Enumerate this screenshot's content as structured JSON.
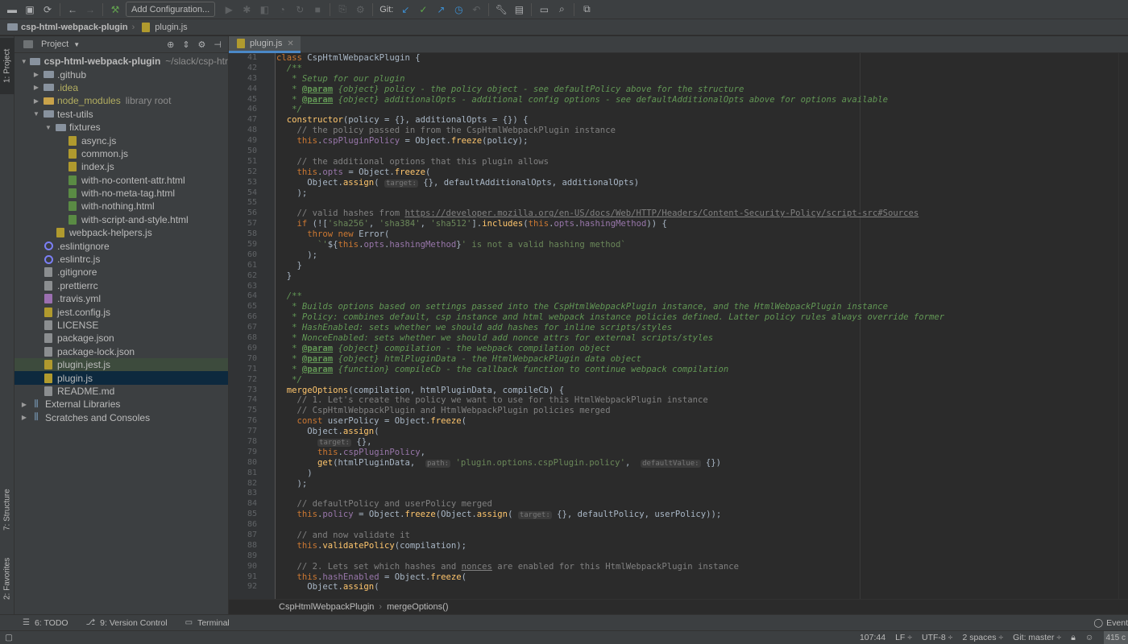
{
  "toolbar": {
    "add_config_label": "Add Configuration...",
    "git_label": "Git:"
  },
  "navbar": {
    "project": "csp-html-webpack-plugin",
    "file": "plugin.js"
  },
  "left_stripe": {
    "project_tab": "1: Project",
    "structure_tab": "7: Structure",
    "favorites_tab": "2: Favorites"
  },
  "project_panel": {
    "title": "Project",
    "tree": [
      {
        "indent": 0,
        "arrow": "▼",
        "icon": "folder",
        "label": "csp-html-webpack-plugin",
        "suffix": "~/slack/csp-htr",
        "bold": true
      },
      {
        "indent": 1,
        "arrow": "▶",
        "icon": "folder",
        "label": ".github"
      },
      {
        "indent": 1,
        "arrow": "▶",
        "icon": "folder",
        "label": ".idea",
        "ignored": true
      },
      {
        "indent": 1,
        "arrow": "▶",
        "icon": "folder-yellow",
        "label": "node_modules",
        "suffix": "library root",
        "ignored": true
      },
      {
        "indent": 1,
        "arrow": "▼",
        "icon": "folder",
        "label": "test-utils"
      },
      {
        "indent": 2,
        "arrow": "▼",
        "icon": "folder",
        "label": "fixtures"
      },
      {
        "indent": 3,
        "arrow": "",
        "icon": "js",
        "label": "async.js"
      },
      {
        "indent": 3,
        "arrow": "",
        "icon": "js",
        "label": "common.js"
      },
      {
        "indent": 3,
        "arrow": "",
        "icon": "js",
        "label": "index.js"
      },
      {
        "indent": 3,
        "arrow": "",
        "icon": "html",
        "label": "with-no-content-attr.html"
      },
      {
        "indent": 3,
        "arrow": "",
        "icon": "html",
        "label": "with-no-meta-tag.html"
      },
      {
        "indent": 3,
        "arrow": "",
        "icon": "html",
        "label": "with-nothing.html"
      },
      {
        "indent": 3,
        "arrow": "",
        "icon": "html",
        "label": "with-script-and-style.html"
      },
      {
        "indent": 2,
        "arrow": "",
        "icon": "js",
        "label": "webpack-helpers.js"
      },
      {
        "indent": 1,
        "arrow": "",
        "icon": "ring",
        "label": ".eslintignore"
      },
      {
        "indent": 1,
        "arrow": "",
        "icon": "ring",
        "label": ".eslintrc.js"
      },
      {
        "indent": 1,
        "arrow": "",
        "icon": "cfg",
        "label": ".gitignore"
      },
      {
        "indent": 1,
        "arrow": "",
        "icon": "cfg",
        "label": ".prettierrc"
      },
      {
        "indent": 1,
        "arrow": "",
        "icon": "yml",
        "label": ".travis.yml"
      },
      {
        "indent": 1,
        "arrow": "",
        "icon": "js",
        "label": "jest.config.js"
      },
      {
        "indent": 1,
        "arrow": "",
        "icon": "cfg",
        "label": "LICENSE"
      },
      {
        "indent": 1,
        "arrow": "",
        "icon": "cfg",
        "label": "package.json"
      },
      {
        "indent": 1,
        "arrow": "",
        "icon": "cfg",
        "label": "package-lock.json"
      },
      {
        "indent": 1,
        "arrow": "",
        "icon": "js",
        "label": "plugin.jest.js",
        "state": "selected-dim"
      },
      {
        "indent": 1,
        "arrow": "",
        "icon": "js",
        "label": "plugin.js",
        "state": "selected"
      },
      {
        "indent": 1,
        "arrow": "",
        "icon": "cfg",
        "label": "README.md"
      },
      {
        "indent": 0,
        "arrow": "▶",
        "icon": "lib",
        "label": "External Libraries"
      },
      {
        "indent": 0,
        "arrow": "▶",
        "icon": "lib",
        "label": "Scratches and Consoles"
      }
    ]
  },
  "editor": {
    "tab_label": "plugin.js",
    "first_line": 41,
    "lines": [
      [
        [
          "k",
          "class "
        ],
        [
          "t",
          "CspHtmlWebpackPlugin {"
        ]
      ],
      [
        [
          "d",
          "  /**"
        ]
      ],
      [
        [
          "d",
          "   * Setup for our plugin"
        ]
      ],
      [
        [
          "d",
          "   * "
        ],
        [
          "dt",
          "@param"
        ],
        [
          "d",
          " {object} policy - the policy object - see defaultPolicy above for the structure"
        ]
      ],
      [
        [
          "d",
          "   * "
        ],
        [
          "dt",
          "@param"
        ],
        [
          "d",
          " {object} additionalOpts - additional config options - see defaultAdditionalOpts above for options available"
        ]
      ],
      [
        [
          "d",
          "   */"
        ]
      ],
      [
        [
          "f",
          "  constructor"
        ],
        [
          "t",
          "(policy = {}, additionalOpts = {}) {"
        ]
      ],
      [
        [
          "c",
          "    // the policy passed in from the CspHtmlWebpackPlugin instance"
        ]
      ],
      [
        [
          "k",
          "    this"
        ],
        [
          "t",
          "."
        ],
        [
          "p",
          "cspPluginPolicy"
        ],
        [
          "t",
          " = Object."
        ],
        [
          "f",
          "freeze"
        ],
        [
          "t",
          "(policy);"
        ]
      ],
      [
        [
          "t",
          ""
        ]
      ],
      [
        [
          "c",
          "    // the additional options that this plugin allows"
        ]
      ],
      [
        [
          "k",
          "    this"
        ],
        [
          "t",
          "."
        ],
        [
          "p",
          "opts"
        ],
        [
          "t",
          " = Object."
        ],
        [
          "f",
          "freeze"
        ],
        [
          "t",
          "("
        ]
      ],
      [
        [
          "t",
          "      Object."
        ],
        [
          "f",
          "assign"
        ],
        [
          "t",
          "( "
        ],
        [
          "h",
          "target:"
        ],
        [
          "t",
          " {}, defaultAdditionalOpts, additionalOpts)"
        ]
      ],
      [
        [
          "t",
          "    );"
        ]
      ],
      [
        [
          "t",
          ""
        ]
      ],
      [
        [
          "c",
          "    // valid hashes from "
        ],
        [
          "cu",
          "https://developer.mozilla.org/en-US/docs/Web/HTTP/Headers/Content-Security-Policy/script-src#Sources"
        ]
      ],
      [
        [
          "k",
          "    if "
        ],
        [
          "t",
          "(!["
        ],
        [
          "s",
          "'sha256'"
        ],
        [
          "t",
          ", "
        ],
        [
          "s",
          "'sha384'"
        ],
        [
          "t",
          ", "
        ],
        [
          "s",
          "'sha512'"
        ],
        [
          "t",
          "]."
        ],
        [
          "f",
          "includes"
        ],
        [
          "t",
          "("
        ],
        [
          "k",
          "this"
        ],
        [
          "t",
          "."
        ],
        [
          "p",
          "opts"
        ],
        [
          "t",
          "."
        ],
        [
          "p",
          "hashingMethod"
        ],
        [
          "t",
          ")) {"
        ]
      ],
      [
        [
          "k",
          "      throw new "
        ],
        [
          "t",
          "Error("
        ]
      ],
      [
        [
          "s",
          "        `'"
        ],
        [
          "t",
          "${"
        ],
        [
          "k",
          "this"
        ],
        [
          "t",
          "."
        ],
        [
          "p",
          "opts"
        ],
        [
          "t",
          "."
        ],
        [
          "p",
          "hashingMethod"
        ],
        [
          "t",
          "}"
        ],
        [
          "s",
          "' is not a valid hashing method`"
        ]
      ],
      [
        [
          "t",
          "      );"
        ]
      ],
      [
        [
          "t",
          "    }"
        ]
      ],
      [
        [
          "t",
          "  }"
        ]
      ],
      [
        [
          "t",
          ""
        ]
      ],
      [
        [
          "d",
          "  /**"
        ]
      ],
      [
        [
          "d",
          "   * Builds options based on settings passed into the CspHtmlWebpackPlugin instance, and the HtmlWebpackPlugin instance"
        ]
      ],
      [
        [
          "d",
          "   * Policy: combines default, csp instance and html webpack instance policies defined. Latter policy rules always override former"
        ]
      ],
      [
        [
          "d",
          "   * HashEnabled: sets whether we should add hashes for inline scripts/styles"
        ]
      ],
      [
        [
          "d",
          "   * NonceEnabled: sets whether we should add nonce attrs for external scripts/styles"
        ]
      ],
      [
        [
          "d",
          "   * "
        ],
        [
          "dt",
          "@param"
        ],
        [
          "d",
          " {object} compilation - the webpack compilation object"
        ]
      ],
      [
        [
          "d",
          "   * "
        ],
        [
          "dt",
          "@param"
        ],
        [
          "d",
          " {object} htmlPluginData - the HtmlWebpackPlugin data object"
        ]
      ],
      [
        [
          "d",
          "   * "
        ],
        [
          "dt",
          "@param"
        ],
        [
          "d",
          " {function} compileCb - the callback function to continue webpack compilation"
        ]
      ],
      [
        [
          "d",
          "   */"
        ]
      ],
      [
        [
          "f",
          "  mergeOptions"
        ],
        [
          "t",
          "(compilation, htmlPluginData, compileCb) {"
        ]
      ],
      [
        [
          "c",
          "    // 1. Let's create the policy we want to use for this HtmlWebpackPlugin instance"
        ]
      ],
      [
        [
          "c",
          "    // CspHtmlWebpackPlugin and HtmlWebpackPlugin policies merged"
        ]
      ],
      [
        [
          "k",
          "    const "
        ],
        [
          "t",
          "userPolicy = Object."
        ],
        [
          "f",
          "freeze"
        ],
        [
          "t",
          "("
        ]
      ],
      [
        [
          "t",
          "      Object."
        ],
        [
          "f",
          "assign"
        ],
        [
          "t",
          "("
        ]
      ],
      [
        [
          "t",
          "        "
        ],
        [
          "h",
          "target:"
        ],
        [
          "t",
          " {},"
        ]
      ],
      [
        [
          "k",
          "        this"
        ],
        [
          "t",
          "."
        ],
        [
          "p",
          "cspPluginPolicy"
        ],
        [
          "t",
          ","
        ]
      ],
      [
        [
          "f",
          "        get"
        ],
        [
          "t",
          "(htmlPluginData,  "
        ],
        [
          "h",
          "path:"
        ],
        [
          "t",
          " "
        ],
        [
          "s",
          "'plugin.options.cspPlugin.policy'"
        ],
        [
          "t",
          ",  "
        ],
        [
          "h",
          "defaultValue:"
        ],
        [
          "t",
          " {})"
        ]
      ],
      [
        [
          "t",
          "      )"
        ]
      ],
      [
        [
          "t",
          "    );"
        ]
      ],
      [
        [
          "t",
          ""
        ]
      ],
      [
        [
          "c",
          "    // defaultPolicy and userPolicy merged"
        ]
      ],
      [
        [
          "k",
          "    this"
        ],
        [
          "t",
          "."
        ],
        [
          "p",
          "policy"
        ],
        [
          "t",
          " = Object."
        ],
        [
          "f",
          "freeze"
        ],
        [
          "t",
          "(Object."
        ],
        [
          "f",
          "assign"
        ],
        [
          "t",
          "( "
        ],
        [
          "h",
          "target:"
        ],
        [
          "t",
          " {}, defaultPolicy, userPolicy));"
        ]
      ],
      [
        [
          "t",
          ""
        ]
      ],
      [
        [
          "c",
          "    // and now validate it"
        ]
      ],
      [
        [
          "k",
          "    this"
        ],
        [
          "t",
          "."
        ],
        [
          "f",
          "validatePolicy"
        ],
        [
          "t",
          "(compilation);"
        ]
      ],
      [
        [
          "t",
          ""
        ]
      ],
      [
        [
          "c",
          "    // 2. Lets set which hashes and "
        ],
        [
          "cu",
          "nonces"
        ],
        [
          "c",
          " are enabled for this HtmlWebpackPlugin instance"
        ]
      ],
      [
        [
          "k",
          "    this"
        ],
        [
          "t",
          "."
        ],
        [
          "p",
          "hashEnabled"
        ],
        [
          "t",
          " = Object."
        ],
        [
          "f",
          "freeze"
        ],
        [
          "t",
          "("
        ]
      ],
      [
        [
          "t",
          "      Object."
        ],
        [
          "f",
          "assign"
        ],
        [
          "t",
          "("
        ]
      ]
    ]
  },
  "breadcrumbs": {
    "class": "CspHtmlWebpackPlugin",
    "method": "mergeOptions()"
  },
  "bottom_tools": {
    "todo": "6: TODO",
    "version_control": "9: Version Control",
    "terminal": "Terminal",
    "event_log": "Event"
  },
  "status": {
    "position": "107:44",
    "line_sep": "LF ÷",
    "encoding": "UTF-8 ÷",
    "indent": "2 spaces ÷",
    "git": "Git: master ÷",
    "memory": "415 c"
  }
}
